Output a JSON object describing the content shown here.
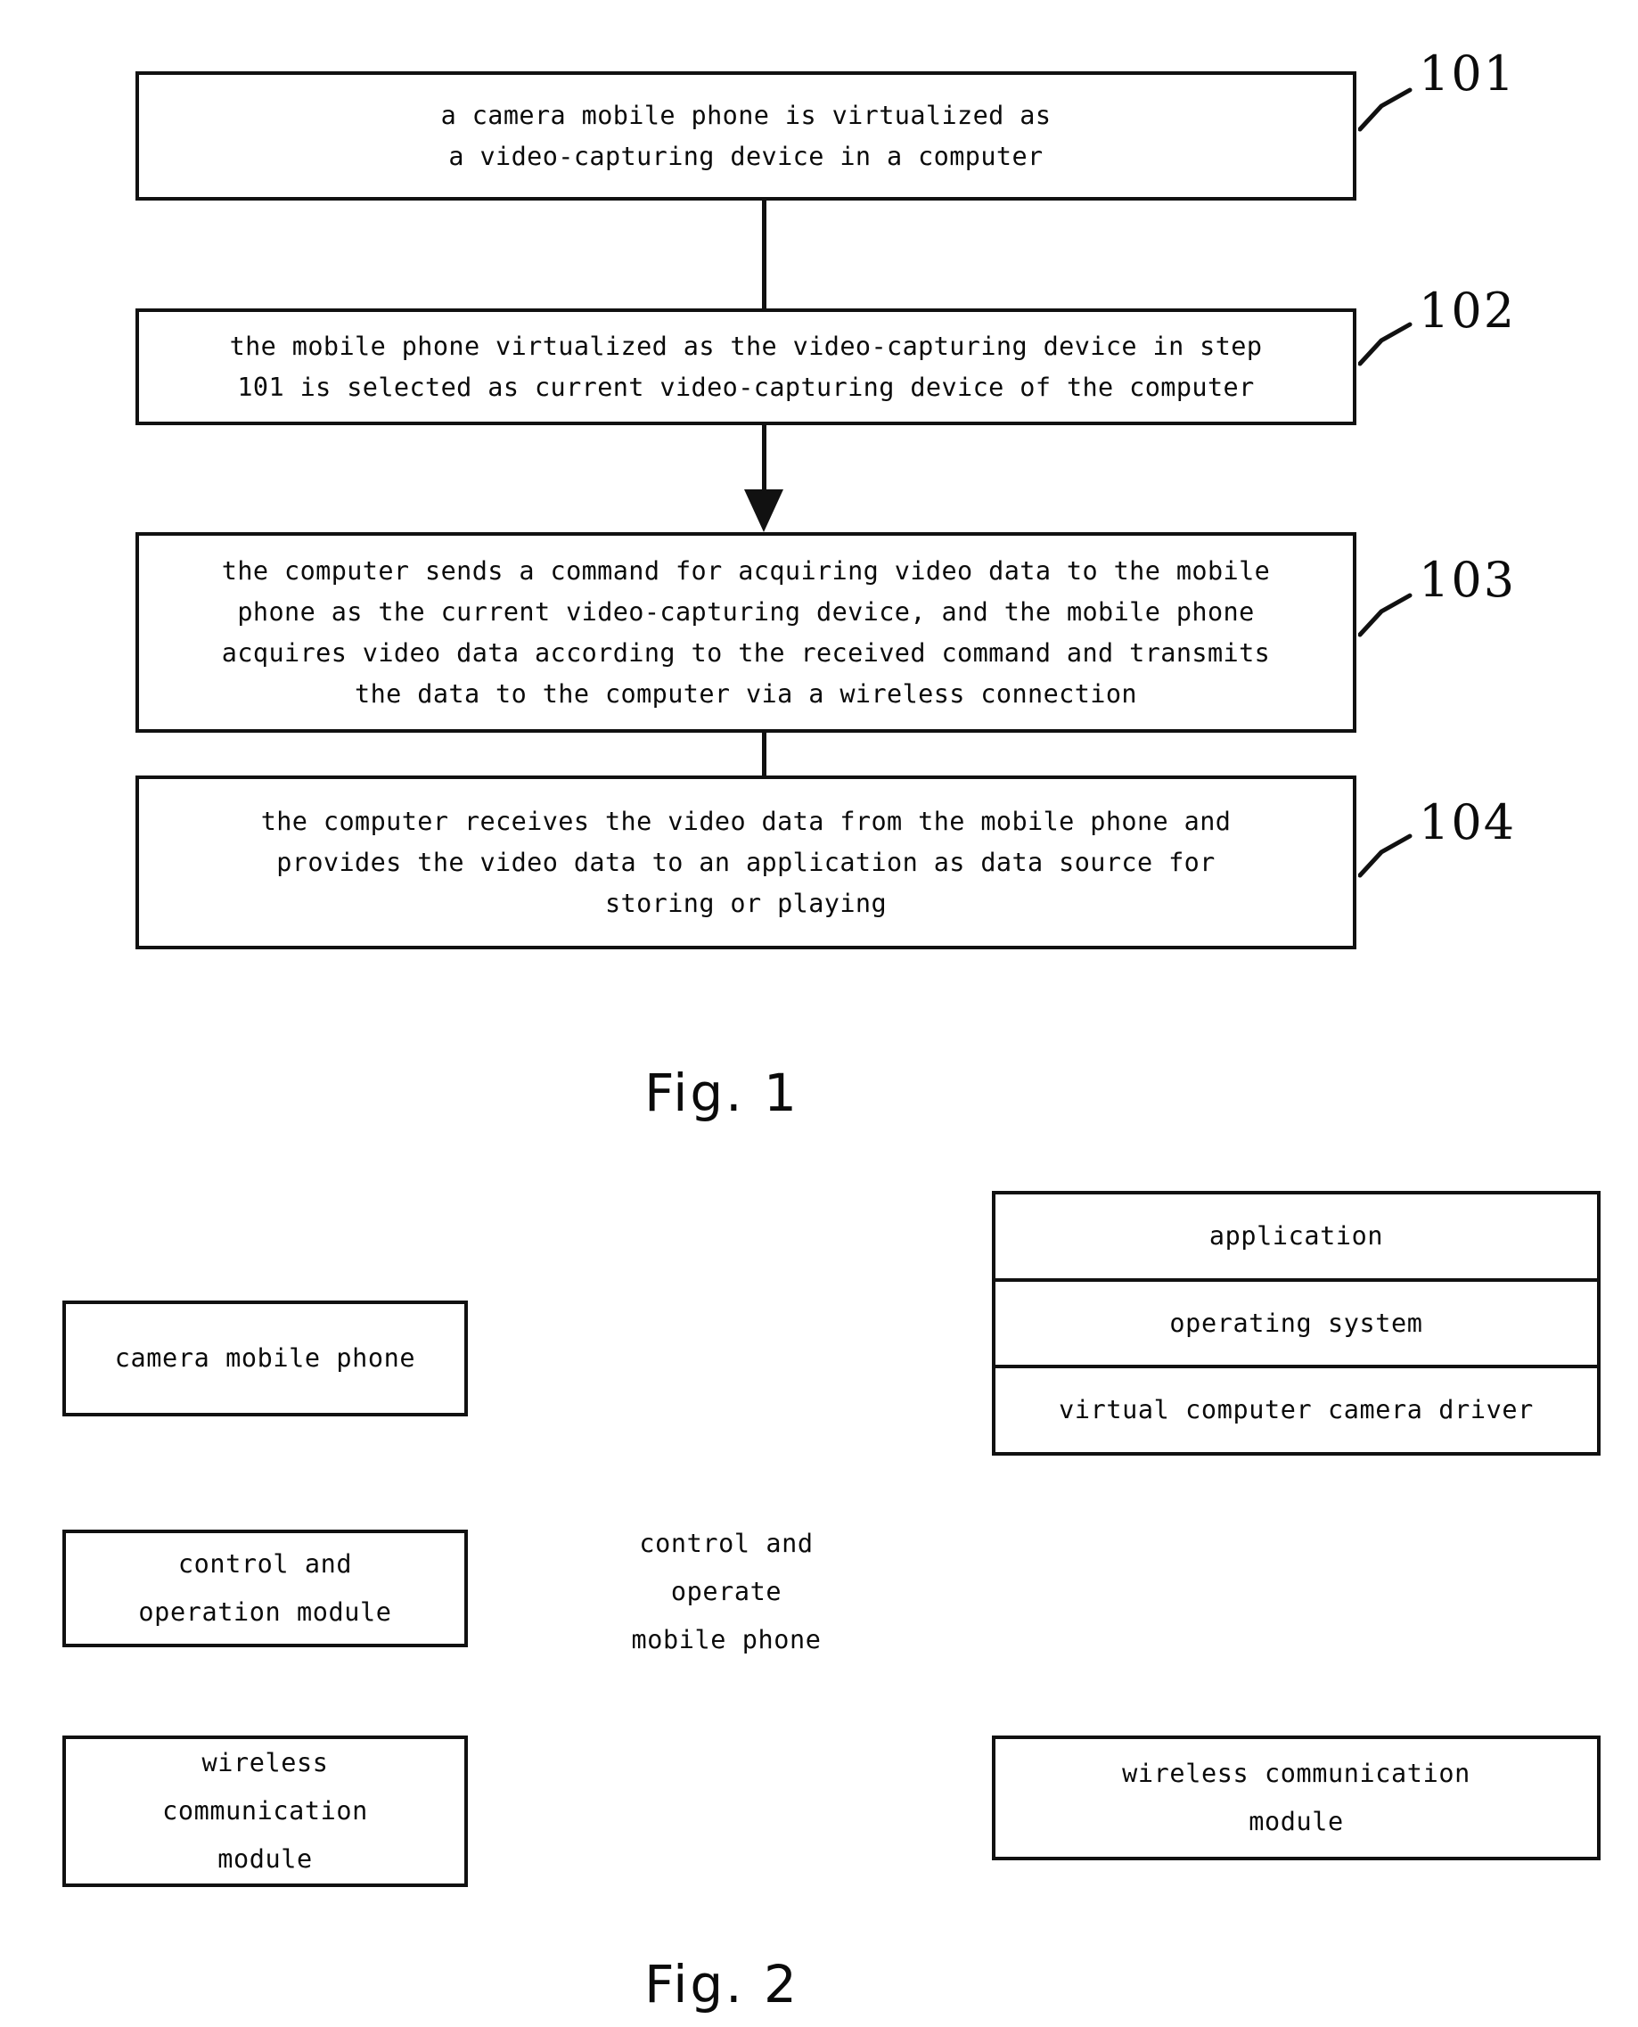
{
  "document": {
    "type": "patent-drawing-sheet",
    "background_color": "#ffffff",
    "ink_color": "#111111"
  },
  "figure1": {
    "caption": "Fig. 1",
    "steps": [
      {
        "ref": "101",
        "text": "a camera mobile phone is virtualized as\na video-capturing device in a computer"
      },
      {
        "ref": "102",
        "text": "the mobile phone virtualized as the video-capturing device in step\n101 is selected as current video-capturing device of the computer"
      },
      {
        "ref": "103",
        "text": "the computer sends a command for acquiring video data to the mobile\nphone as the current video-capturing device, and the mobile phone\nacquires video data according to the received command and transmits\nthe data to the computer via a wireless connection"
      },
      {
        "ref": "104",
        "text": "the computer receives the video data from the mobile phone and\nprovides the video data to an application as data source for\nstoring or playing"
      }
    ]
  },
  "figure2": {
    "caption": "Fig. 2",
    "left_column": [
      {
        "text": "camera mobile phone"
      },
      {
        "text": "control and\noperation module"
      },
      {
        "text": "wireless\ncommunication\nmodule"
      }
    ],
    "middle_label": "control and\noperate\nmobile phone",
    "right_stack": [
      {
        "text": "application"
      },
      {
        "text": "operating system"
      },
      {
        "text": "virtual computer camera driver"
      }
    ],
    "right_bottom": {
      "text": "wireless communication\nmodule"
    }
  }
}
